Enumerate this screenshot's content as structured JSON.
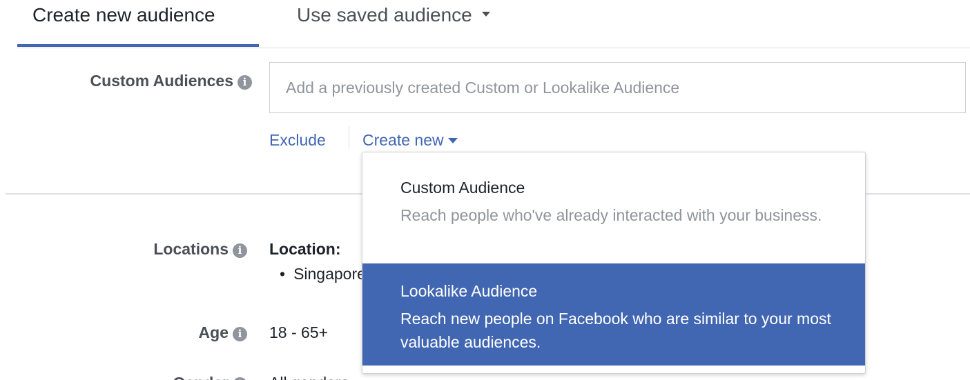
{
  "tabs": {
    "create_new": "Create new audience",
    "use_saved": "Use saved audience"
  },
  "custom_audiences": {
    "label": "Custom Audiences",
    "info_icon": "info-icon",
    "input_placeholder": "Add a previously created Custom or Lookalike Audience",
    "exclude_label": "Exclude",
    "create_new_label": "Create new"
  },
  "dropdown": {
    "items": [
      {
        "title": "Custom Audience",
        "description": "Reach people who've already interacted with your business."
      },
      {
        "title": "Lookalike Audience",
        "description": "Reach new people on Facebook who are similar to your most valuable audiences.",
        "highlighted": true
      }
    ]
  },
  "locations": {
    "label": "Locations",
    "title": "Location:",
    "items": [
      "Singapore"
    ]
  },
  "age": {
    "label": "Age",
    "value": "18 - 65+"
  },
  "gender": {
    "label": "Gender",
    "value": "All genders"
  },
  "colors": {
    "accent": "#4267b2",
    "text": "#1d2129",
    "secondary_text": "#4b4f56",
    "placeholder": "#90949c",
    "divider": "#dddfe2"
  }
}
